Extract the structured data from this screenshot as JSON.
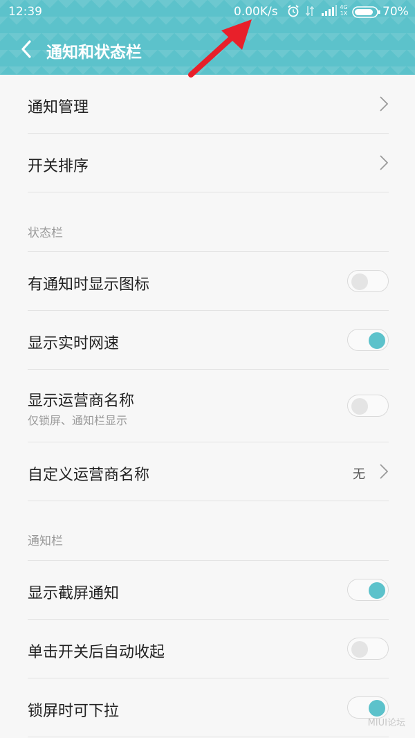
{
  "status_bar": {
    "time": "12:39",
    "speed": "0.00K/s",
    "battery": "70%",
    "icons": [
      "alarm-icon",
      "data-transfer-icon",
      "signal-icon",
      "network-4g-1x-icon",
      "battery-icon"
    ],
    "net_top": "4G",
    "net_bottom": "1X"
  },
  "header": {
    "title": "通知和状态栏",
    "back_icon": "back-arrow-icon",
    "bg_color": "#5cc2cb"
  },
  "menu": {
    "notification_management": "通知管理",
    "switch_order": "开关排序"
  },
  "status_bar_section": {
    "title": "状态栏",
    "show_icon_on_notification": {
      "label": "有通知时显示图标",
      "enabled": false
    },
    "show_realtime_speed": {
      "label": "显示实时网速",
      "enabled": true
    },
    "show_carrier_name": {
      "label": "显示运营商名称",
      "sub": "仅锁屏、通知栏显示",
      "enabled": false
    },
    "custom_carrier_name": {
      "label": "自定义运营商名称",
      "value": "无"
    }
  },
  "notification_section": {
    "title": "通知栏",
    "show_screenshot_notification": {
      "label": "显示截屏通知",
      "enabled": true
    },
    "auto_collapse_after_switch": {
      "label": "单击开关后自动收起",
      "enabled": false
    },
    "pull_down_on_lock": {
      "label": "锁屏时可下拉",
      "enabled": true
    }
  },
  "watermark": "MIUI论坛",
  "colors": {
    "accent": "#5cc2cb",
    "annotation_arrow": "#e8202a"
  }
}
